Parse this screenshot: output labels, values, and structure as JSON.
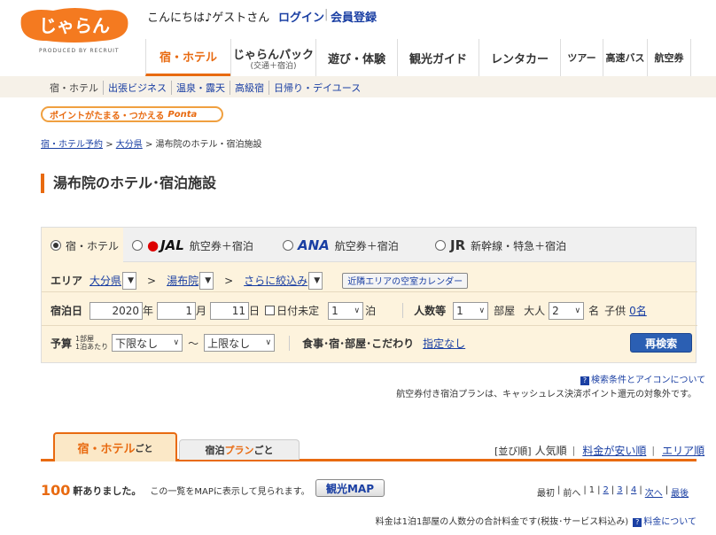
{
  "header": {
    "logo_text": "じゃらん",
    "logo_sub": "PRODUCED BY RECRUIT",
    "greeting": "こんにちは♪ゲストさん",
    "login": "ログイン",
    "separator": "|",
    "register": "会員登録"
  },
  "nav": [
    {
      "label": "宿・ホテル",
      "sub": ""
    },
    {
      "label": "じゃらんパック",
      "sub": "(交通＋宿泊)"
    },
    {
      "label": "遊び・体験",
      "sub": ""
    },
    {
      "label": "観光ガイド",
      "sub": ""
    },
    {
      "label": "レンタカー",
      "sub": ""
    },
    {
      "label": "ツアー",
      "sub": ""
    },
    {
      "label": "高速バス",
      "sub": ""
    },
    {
      "label": "航空券",
      "sub": ""
    }
  ],
  "subnav": [
    "宿・ホテル",
    "出張ビジネス",
    "温泉・露天",
    "高級宿",
    "日帰り・デイユース"
  ],
  "ponta": {
    "text": "ポイントがたまる・つかえる",
    "logo": "Ponta"
  },
  "breadcrumb": {
    "home": "宿・ホテル予約",
    "sep": ">",
    "pref": "大分県",
    "current": "湯布院のホテル・宿泊施設"
  },
  "page_title": "湯布院のホテル･宿泊施設",
  "search_tabs": [
    {
      "brand": "",
      "label": "宿・ホテル"
    },
    {
      "brand": "JAL",
      "label": "航空券＋宿泊"
    },
    {
      "brand": "ANA",
      "label": "航空券＋宿泊"
    },
    {
      "brand": "JR",
      "label": "新幹線・特急＋宿泊"
    }
  ],
  "search": {
    "area_label": "エリア",
    "area_pref": "大分県",
    "area_sep": ">",
    "area_city": "湯布院",
    "area_more": "さらに絞込み",
    "calendar_btn": "近隣エリアの空室カレンダー",
    "date_label": "宿泊日",
    "year": "2020",
    "year_unit": "年",
    "month": "1",
    "month_unit": "月",
    "day": "11",
    "day_unit": "日",
    "undecided": "日付未定",
    "nights": "1",
    "nights_unit": "泊",
    "people_label": "人数等",
    "rooms": "1",
    "rooms_unit": "部屋",
    "adults_label": "大人",
    "adults": "2",
    "adults_unit": "名",
    "children_label": "子供",
    "children": "0名",
    "budget_label": "予算",
    "budget_sub1": "1部屋",
    "budget_sub2": "1泊あたり",
    "budget_min": "下限なし",
    "budget_tilde": "〜",
    "budget_max": "上限なし",
    "conditions_label": "食事･宿･部屋･こだわり",
    "conditions_value": "指定なし",
    "submit": "再検索"
  },
  "help_link": "検索条件とアイコンについて",
  "notice": "航空券付き宿泊プランは、キャッシュレス決済ポイント還元の対象外です。",
  "list_tabs": {
    "hotel": "宿・ホテル",
    "hotel_suffix": "ごと",
    "plan_prefix": "宿泊",
    "plan": "プラン",
    "plan_suffix": "ごと"
  },
  "sort": {
    "label": "[並び順]",
    "current": "人気順",
    "cheap": "料金が安い順",
    "area": "エリア順"
  },
  "results": {
    "count": "100",
    "count_text": "軒ありました。",
    "map_note": "この一覧をMAPに表示して見られます。",
    "map_button": "観光MAP"
  },
  "pager": [
    "最初",
    "前へ",
    "1",
    "2",
    "3",
    "4",
    "次へ",
    "最後"
  ],
  "price_note": {
    "text": "料金は1泊1部屋の人数分の合計料金です(税抜･サービス料込み)",
    "link": "料金について"
  },
  "colors": {
    "accent": "#e86a10",
    "link": "#1a3fa3",
    "panel": "#fdf3dd"
  }
}
